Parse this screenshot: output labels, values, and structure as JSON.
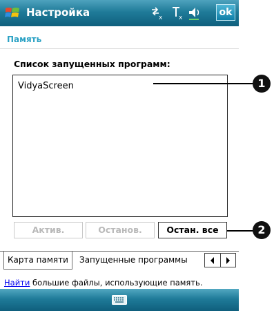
{
  "titlebar": {
    "title": "Настройка",
    "ok_label": "ok",
    "icons": [
      "windows-start-icon",
      "connectivity-icon",
      "signal-icon",
      "volume-icon"
    ]
  },
  "section": {
    "title": "Память"
  },
  "running_programs": {
    "label": "Список запущенных программ:",
    "items": [
      "VidyaScreen"
    ]
  },
  "buttons": {
    "activate": "Актив.",
    "stop": "Останов.",
    "stop_all": "Остан. все"
  },
  "tabs": [
    {
      "label": "Карта памяти",
      "selected": false
    },
    {
      "label": "Запущенные программы",
      "selected": true
    }
  ],
  "hint": {
    "link_text": "Найти",
    "text": " большие файлы, использующие память."
  },
  "callouts": [
    "1",
    "2"
  ],
  "colors": {
    "titlebar": "#1f7b99",
    "section_title": "#2aa1c4",
    "link": "#0000ee",
    "disabled_text": "#b9b9b9"
  }
}
